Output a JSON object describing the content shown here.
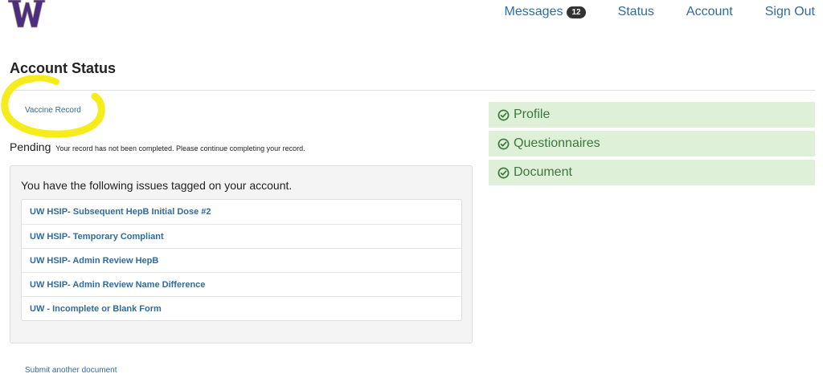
{
  "brand": {
    "logo_letter": "W",
    "color": "#4b2e83",
    "accent": "#b7a57a"
  },
  "nav": {
    "messages_label": "Messages",
    "messages_count": "12",
    "status_label": "Status",
    "account_label": "Account",
    "signout_label": "Sign Out"
  },
  "page": {
    "title": "Account Status",
    "vaccine_link": "Vaccine Record",
    "pending_label": "Pending",
    "pending_message": "Your record has not been completed. Please continue completing your record."
  },
  "issues": {
    "heading": "You have the following issues tagged on your account.",
    "items": [
      "UW HSIP- Subsequent HepB Initial Dose #2",
      "UW HSIP- Temporary Compliant",
      "UW HSIP- Admin Review HepB",
      "UW HSIP- Admin Review Name Difference",
      "UW - Incomplete or Blank Form"
    ]
  },
  "submit_link": "Submit another document",
  "status_items": [
    {
      "label": "Profile",
      "icon": "check-circle-icon"
    },
    {
      "label": "Questionnaires",
      "icon": "check-circle-icon"
    },
    {
      "label": "Document",
      "icon": "check-circle-icon"
    }
  ],
  "colors": {
    "link": "#2f6b9e",
    "success_bg": "#dff0d8",
    "success_text": "#3c763d",
    "highlight": "#f7ec1b"
  }
}
